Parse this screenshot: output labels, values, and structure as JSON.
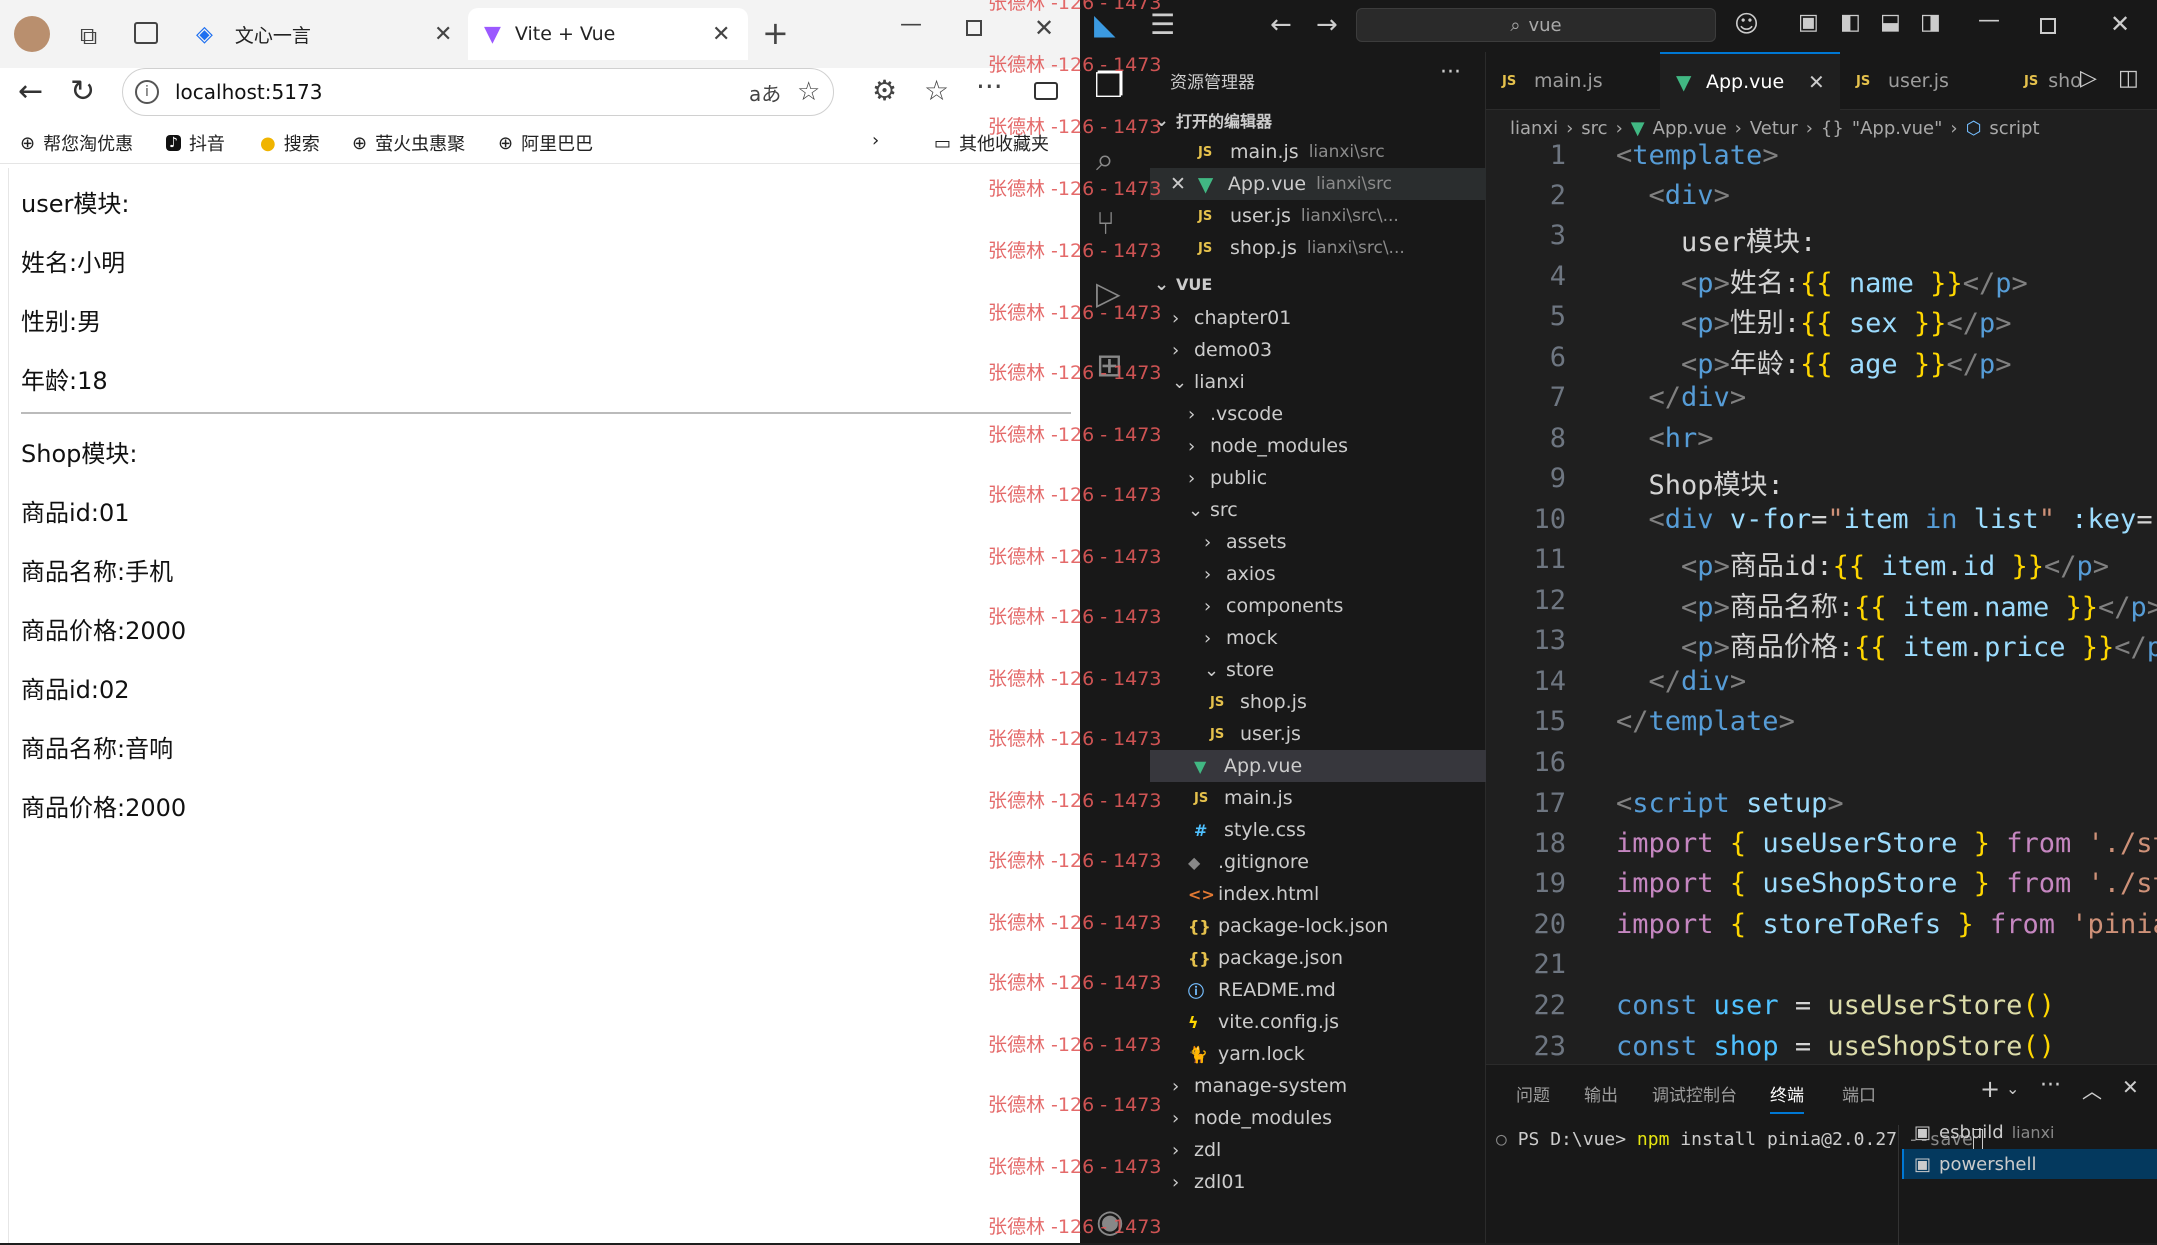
{
  "browser": {
    "tabs": [
      {
        "label": "文心一言",
        "active": false
      },
      {
        "label": "Vite + Vue",
        "active": true
      }
    ],
    "address": "localhost:5173",
    "bookmarks": [
      "帮您淘优惠",
      "抖音",
      "搜索",
      "萤火虫惠聚",
      "阿里巴巴"
    ],
    "other_bookmarks": "其他收藏夹",
    "page": {
      "user_heading": "user模块:",
      "user_lines": [
        "姓名:小明",
        "性别:男",
        "年龄:18"
      ],
      "shop_heading": "Shop模块:",
      "shop_lines": [
        "商品id:01",
        "商品名称:手机",
        "商品价格:2000",
        "商品id:02",
        "商品名称:音响",
        "商品价格:2000"
      ]
    }
  },
  "watermark": "张德林 -126 - 1473",
  "vscode": {
    "search": "vue",
    "explorer_title": "资源管理器",
    "open_editors_title": "打开的编辑器",
    "open_editors": [
      {
        "name": "main.js",
        "path": "lianxi\\src",
        "type": "js"
      },
      {
        "name": "App.vue",
        "path": "lianxi\\src",
        "type": "vue"
      },
      {
        "name": "user.js",
        "path": "lianxi\\src\\...",
        "type": "js"
      },
      {
        "name": "shop.js",
        "path": "lianxi\\src\\...",
        "type": "js"
      }
    ],
    "workspace_title": "VUE",
    "tree": [
      {
        "name": "chapter01",
        "depth": 0,
        "type": "folder",
        "open": false
      },
      {
        "name": "demo03",
        "depth": 0,
        "type": "folder",
        "open": false
      },
      {
        "name": "lianxi",
        "depth": 0,
        "type": "folder",
        "open": true
      },
      {
        "name": ".vscode",
        "depth": 1,
        "type": "folder",
        "open": false
      },
      {
        "name": "node_modules",
        "depth": 1,
        "type": "folder",
        "open": false
      },
      {
        "name": "public",
        "depth": 1,
        "type": "folder",
        "open": false
      },
      {
        "name": "src",
        "depth": 1,
        "type": "folder",
        "open": true
      },
      {
        "name": "assets",
        "depth": 2,
        "type": "folder",
        "open": false
      },
      {
        "name": "axios",
        "depth": 2,
        "type": "folder",
        "open": false
      },
      {
        "name": "components",
        "depth": 2,
        "type": "folder",
        "open": false
      },
      {
        "name": "mock",
        "depth": 2,
        "type": "folder",
        "open": false
      },
      {
        "name": "store",
        "depth": 2,
        "type": "folder",
        "open": true
      },
      {
        "name": "shop.js",
        "depth": 3,
        "type": "js"
      },
      {
        "name": "user.js",
        "depth": 3,
        "type": "js"
      },
      {
        "name": "App.vue",
        "depth": 2,
        "type": "vue",
        "selected": true
      },
      {
        "name": "main.js",
        "depth": 2,
        "type": "js"
      },
      {
        "name": "style.css",
        "depth": 2,
        "type": "css"
      },
      {
        "name": ".gitignore",
        "depth": 1,
        "type": "git"
      },
      {
        "name": "index.html",
        "depth": 1,
        "type": "html"
      },
      {
        "name": "package-lock.json",
        "depth": 1,
        "type": "json"
      },
      {
        "name": "package.json",
        "depth": 1,
        "type": "json"
      },
      {
        "name": "README.md",
        "depth": 1,
        "type": "info"
      },
      {
        "name": "vite.config.js",
        "depth": 1,
        "type": "vite"
      },
      {
        "name": "yarn.lock",
        "depth": 1,
        "type": "yarn"
      },
      {
        "name": "manage-system",
        "depth": 0,
        "type": "folder",
        "open": false
      },
      {
        "name": "node_modules",
        "depth": 0,
        "type": "folder",
        "open": false
      },
      {
        "name": "zdl",
        "depth": 0,
        "type": "folder",
        "open": false
      },
      {
        "name": "zdl01",
        "depth": 0,
        "type": "folder",
        "open": false
      }
    ],
    "editor_tabs": [
      {
        "label": "main.js",
        "type": "js",
        "active": false
      },
      {
        "label": "App.vue",
        "type": "vue",
        "active": true
      },
      {
        "label": "user.js",
        "type": "js",
        "active": false
      },
      {
        "label": "sho",
        "type": "js",
        "active": false
      }
    ],
    "breadcrumb": [
      "lianxi",
      "src",
      "App.vue",
      "Vetur",
      "\"App.vue\"",
      "script"
    ],
    "line_numbers": [
      "1",
      "2",
      "3",
      "4",
      "5",
      "6",
      "7",
      "8",
      "9",
      "10",
      "11",
      "12",
      "13",
      "14",
      "15",
      "16",
      "17",
      "18",
      "19",
      "20",
      "21",
      "22",
      "23"
    ],
    "panel_tabs": [
      "问题",
      "输出",
      "调试控制台",
      "终端",
      "端口"
    ],
    "active_panel_tab": "终端",
    "terminal_prompt": "PS D:\\vue>",
    "terminal_cmd": "npm",
    "terminal_args": "install pinia@2.0.27",
    "terminal_flag": "--save",
    "terminals": [
      {
        "name": "esbuild",
        "desc": "lianxi"
      },
      {
        "name": "powershell",
        "desc": ""
      }
    ]
  },
  "colors": {
    "accent": "#0078d4",
    "vue": "#41b883",
    "watermark": "#e25a5a"
  }
}
